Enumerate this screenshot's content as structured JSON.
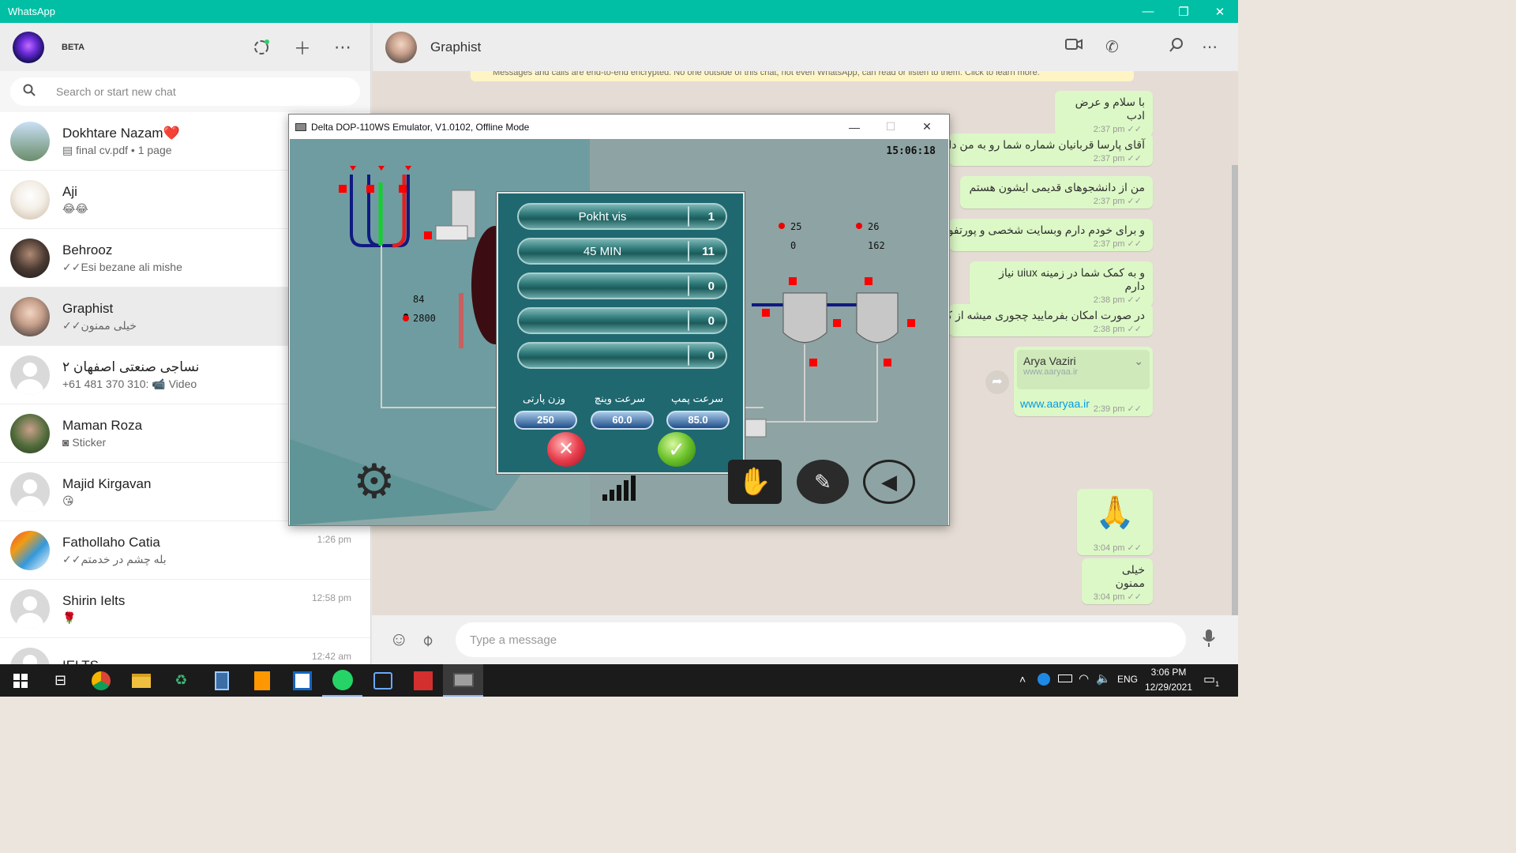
{
  "window": {
    "title": "WhatsApp",
    "minimize": "—",
    "maximize": "❐",
    "close": "✕"
  },
  "left": {
    "beta": "BETA",
    "search_placeholder": "Search or start new chat",
    "chats": [
      {
        "name": "Dokhtare Nazam❤️",
        "msg": "final cv.pdf • 1 page",
        "time": ""
      },
      {
        "name": "Aji",
        "msg": "😂😂",
        "time": ""
      },
      {
        "name": "Behrooz",
        "msg": "Esi bezane ali mishe",
        "time": ""
      },
      {
        "name": "Graphist",
        "msg": "خیلی ممنون",
        "time": ""
      },
      {
        "name": "نساجی صنعتی اصفهان ۲",
        "msg": "+61 481 370 310: 📹 Video",
        "time": ""
      },
      {
        "name": "Maman Roza",
        "msg": "Sticker",
        "time": ""
      },
      {
        "name": "Majid Kirgavan",
        "msg": "😘",
        "time": ""
      },
      {
        "name": "Fathollaho Catia",
        "msg": "بله چشم در خدمتم",
        "time": "1:26 pm"
      },
      {
        "name": "Shirin Ielts",
        "msg": "🌹",
        "time": "12:58 pm"
      },
      {
        "name": "IELTS",
        "msg": "",
        "time": "12:42 am"
      }
    ]
  },
  "conversation": {
    "contact": "Graphist",
    "encryption": "Messages and calls are end-to-end encrypted. No one outside of this chat, not even WhatsApp, can read or listen to them. Click to learn more.",
    "messages": [
      {
        "text": "با سلام و عرض ادب",
        "time": "2:37 pm"
      },
      {
        "text": "آقای پارسا قربانیان شماره شما رو به من داد",
        "time": "2:37 pm"
      },
      {
        "text": "من از دانشجوهای قدیمی ایشون هستم",
        "time": "2:37 pm"
      },
      {
        "text": "و برای خودم دارم وبسایت شخصی و پورتفول",
        "time": "2:37 pm"
      },
      {
        "text": "و به کمک شما در زمینه uiux نیاز دارم",
        "time": "2:38 pm"
      },
      {
        "text": "در صورت امکان بفرمایید چجوری میشه از کم",
        "time": "2:38 pm"
      },
      {
        "contact": "Arya Vaziri",
        "site": "www.aaryaa.ir",
        "link": "www.aaryaa.ir",
        "time": "2:39 pm"
      },
      {
        "text": "🙏",
        "time": "3:04 pm"
      },
      {
        "text": "خیلی ممنون",
        "time": "3:04 pm"
      }
    ],
    "input_placeholder": "Type a message"
  },
  "emulator": {
    "title": "Delta DOP-110WS Emulator, V1.0102, Offline Mode",
    "clock": "15:06:18",
    "left_temp": "84",
    "left_press": "2800",
    "tank1_temp": "25",
    "tank1_press": "0",
    "tank2_temp": "26",
    "tank2_press": "162",
    "rows": [
      {
        "label": "Pokht vis",
        "num": "1"
      },
      {
        "label": "45 MIN",
        "num": "11"
      },
      {
        "label": "",
        "num": "0"
      },
      {
        "label": "",
        "num": "0"
      },
      {
        "label": "",
        "num": "0"
      }
    ],
    "params": [
      {
        "label": "وزن پارتی",
        "value": "250"
      },
      {
        "label": "سرعت وینچ",
        "value": "60.0"
      },
      {
        "label": "سرعت پمپ",
        "value": "85.0"
      }
    ]
  },
  "taskbar": {
    "lang": "ENG",
    "time": "3:06 PM",
    "date": "12/29/2021",
    "notif": "1"
  }
}
